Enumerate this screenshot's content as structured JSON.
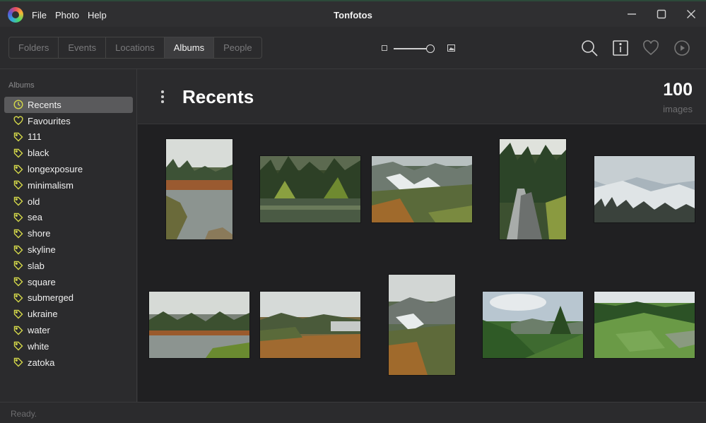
{
  "window": {
    "title": "Tonfotos",
    "menu": [
      "File",
      "Photo",
      "Help"
    ]
  },
  "toolbar": {
    "tabs": [
      {
        "label": "Folders",
        "active": false
      },
      {
        "label": "Events",
        "active": false
      },
      {
        "label": "Locations",
        "active": false
      },
      {
        "label": "Albums",
        "active": true
      },
      {
        "label": "People",
        "active": false
      }
    ],
    "zoom_level": 0.9,
    "icons": [
      "search-icon",
      "info-icon",
      "heart-icon",
      "play-icon"
    ]
  },
  "sidebar": {
    "header": "Albums",
    "albums": [
      {
        "label": "Recents",
        "icon": "clock-icon",
        "selected": true
      },
      {
        "label": "Favourites",
        "icon": "heart-icon",
        "selected": false
      },
      {
        "label": "111",
        "icon": "tag-icon",
        "selected": false
      },
      {
        "label": "black",
        "icon": "tag-icon",
        "selected": false
      },
      {
        "label": "longexposure",
        "icon": "tag-icon",
        "selected": false
      },
      {
        "label": "minimalism",
        "icon": "tag-icon",
        "selected": false
      },
      {
        "label": "old",
        "icon": "tag-icon",
        "selected": false
      },
      {
        "label": "sea",
        "icon": "tag-icon",
        "selected": false
      },
      {
        "label": "shore",
        "icon": "tag-icon",
        "selected": false
      },
      {
        "label": "skyline",
        "icon": "tag-icon",
        "selected": false
      },
      {
        "label": "slab",
        "icon": "tag-icon",
        "selected": false
      },
      {
        "label": "square",
        "icon": "tag-icon",
        "selected": false
      },
      {
        "label": "submerged",
        "icon": "tag-icon",
        "selected": false
      },
      {
        "label": "ukraine",
        "icon": "tag-icon",
        "selected": false
      },
      {
        "label": "water",
        "icon": "tag-icon",
        "selected": false
      },
      {
        "label": "white",
        "icon": "tag-icon",
        "selected": false
      },
      {
        "label": "zatoka",
        "icon": "tag-icon",
        "selected": false
      }
    ]
  },
  "main": {
    "title": "Recents",
    "count": "100",
    "count_label": "images"
  },
  "status": {
    "text": "Ready."
  },
  "colors": {
    "accent": "#d4d84a",
    "selected_bg": "#5a5a5c"
  }
}
